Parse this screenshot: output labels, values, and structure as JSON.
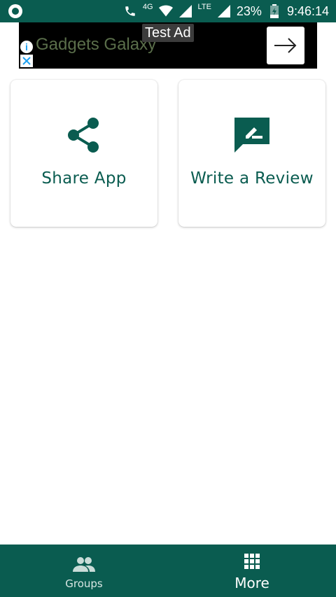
{
  "status_bar": {
    "network_label": "4G",
    "lte_label": "LTE",
    "battery": "23%",
    "time": "9:46:14"
  },
  "ad": {
    "test_label": "Test Ad",
    "title": "Gadgets Galaxy",
    "info_icon": "i"
  },
  "cards": {
    "share": {
      "label": "Share App",
      "icon": "share-icon"
    },
    "review": {
      "label": "Write a Review",
      "icon": "rate-review-icon"
    }
  },
  "bottom_nav": {
    "groups": {
      "label": "Groups",
      "icon": "groups-icon"
    },
    "more": {
      "label": "More",
      "icon": "grid-icon"
    }
  },
  "colors": {
    "primary": "#0a5c50",
    "ad_background": "#000000",
    "ad_title": "#5a6e4a"
  }
}
